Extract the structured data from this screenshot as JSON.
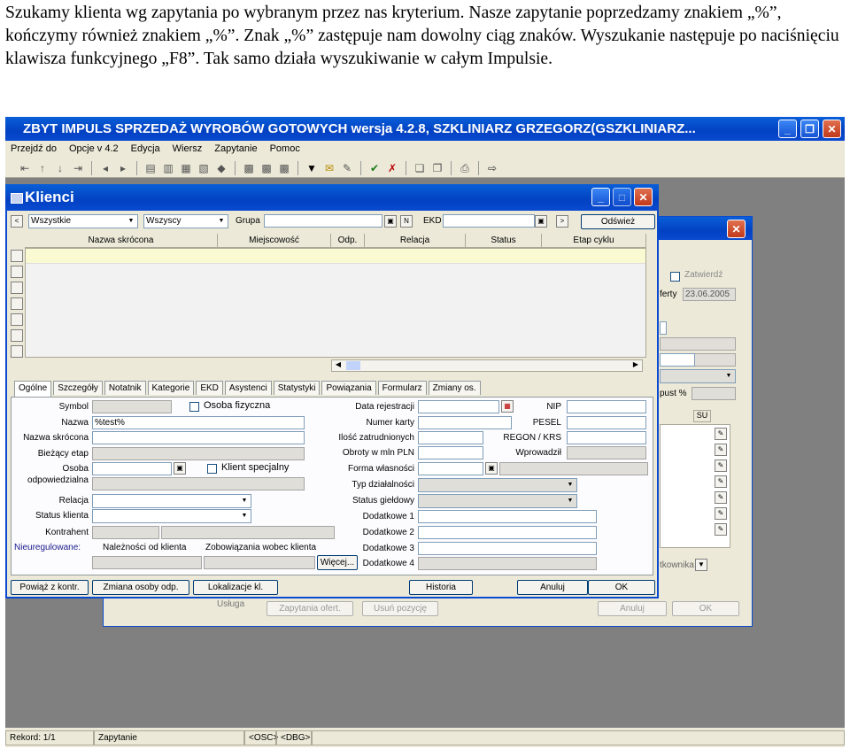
{
  "intro": {
    "text": "Szukamy klienta wg zapytania po wybranym przez nas kryterium. Nasze zapytanie poprzedzamy znakiem „%”, kończymy również znakiem „%”. Znak „%” zastępuje nam dowolny ciąg znaków. Wyszukanie następuje po naciśnięciu klawisza funkcyjnego „F8”. Tak samo działa wyszukiwanie w całym Impulsie."
  },
  "main_window": {
    "title": "ZBYT IMPULS SPRZEDAŻ WYROBÓW GOTOWYCH wersja 4.2.8, SZKLINIARZ GRZEGORZ(GSZKLINIARZ...",
    "menu": [
      "Przejdź do",
      "Opcje v 4.2",
      "Edycja",
      "Wiersz",
      "Zapytanie",
      "Pomoc"
    ],
    "status": {
      "record": "Rekord: 1/1",
      "mode": "Zapytanie",
      "osc": "<OSC>",
      "dbg": "<DBG>"
    }
  },
  "bg_window": {
    "zatwierdz": "Zatwierdź",
    "oferty_label": "ferty",
    "oferty_date": "23.06.2005",
    "upust_label": "pust %",
    "su": "SU",
    "usluga": "Usługa",
    "handlowca": "tkownika",
    "buttons": {
      "zapytania": "Zapytania ofert.",
      "usun": "Usuń pozycję",
      "anuluj": "Anuluj",
      "ok": "OK"
    }
  },
  "klienci": {
    "title": "Klienci",
    "filter1": "Wszystkie",
    "filter2": "Wszyscy",
    "grupa_label": "Grupa",
    "n_label": "N",
    "ekd_label": "EKD",
    "odswiez": "Odśwież",
    "columns": [
      "Nazwa skrócona",
      "Miejscowość",
      "Odp.",
      "Relacja",
      "Status",
      "Etap cyklu"
    ],
    "tabs": [
      "Ogólne",
      "Szczegóły",
      "Notatnik",
      "Kategorie",
      "EKD",
      "Asystenci",
      "Statystyki",
      "Powiązania",
      "Formularz",
      "Zmiany os."
    ],
    "labels": {
      "symbol": "Symbol",
      "osoba_fizyczna": "Osoba fizyczna",
      "nazwa": "Nazwa",
      "nazwa_skrocona": "Nazwa skrócona",
      "biezacy_etap": "Bieżący etap",
      "osoba": "Osoba",
      "odpowiedzialna": "odpowiedzialna",
      "klient_specjalny": "Klient specjalny",
      "relacja": "Relacja",
      "status_klienta": "Status klienta",
      "kontrahent": "Kontrahent",
      "nieuregulowane": "Nieuregulowane:",
      "naleznosci": "Należności od klienta",
      "zobowiazania": "Zobowiązania wobec klienta",
      "wiecej": "Więcej...",
      "data_rejestracji": "Data rejestracji",
      "numer_karty": "Numer karty",
      "ilosc_zatrudnionych": "Ilość zatrudnionych",
      "obroty": "Obroty w mln PLN",
      "forma_wlasnosci": "Forma własności",
      "typ_dzialalnosci": "Typ działalności",
      "status_gieldowy": "Status giełdowy",
      "dodatkowe1": "Dodatkowe 1",
      "dodatkowe2": "Dodatkowe 2",
      "dodatkowe3": "Dodatkowe 3",
      "dodatkowe4": "Dodatkowe 4",
      "nip": "NIP",
      "pesel": "PESEL",
      "regon": "REGON / KRS",
      "wprowadzil": "Wprowadził"
    },
    "nazwa_value": "%test%",
    "buttons": {
      "powiaz": "Powiąż z kontr.",
      "zmiana": "Zmiana osoby odp.",
      "lokalizacje": "Lokalizacje kl.",
      "historia": "Historia",
      "anuluj": "Anuluj",
      "ok": "OK"
    }
  }
}
